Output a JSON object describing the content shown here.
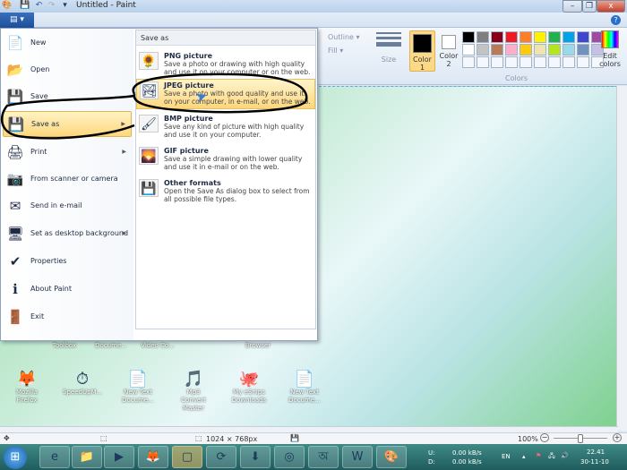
{
  "window": {
    "title": "Untitled - Paint",
    "minimize": "–",
    "restore": "❐",
    "close": "x",
    "help": "?"
  },
  "quick_access": {
    "paint": "🎨",
    "save": "💾",
    "undo": "↶",
    "redo": "↷",
    "customize": "▾"
  },
  "file_button": "▤ ▾",
  "ribbon": {
    "outline": "Outline ▾",
    "fill": "Fill ▾",
    "size": "Size",
    "color1": "Color 1",
    "color2": "Color 2",
    "edit_colors": "Edit colors",
    "colors_group": "Colors",
    "color1_value": "#000000",
    "color2_value": "#ffffff",
    "palette_row1": [
      "#000000",
      "#7f7f7f",
      "#880015",
      "#ed1c24",
      "#ff7f27",
      "#fff200",
      "#22b14c",
      "#00a2e8",
      "#3f48cc",
      "#a349a4"
    ],
    "palette_row2": [
      "#ffffff",
      "#c3c3c3",
      "#b97a57",
      "#ffaec9",
      "#ffc90e",
      "#efe4b0",
      "#b5e61d",
      "#99d9ea",
      "#7092be",
      "#c8bfe7"
    ]
  },
  "file_menu": {
    "items": [
      {
        "label": "New",
        "icon": "📄"
      },
      {
        "label": "Open",
        "icon": "📂"
      },
      {
        "label": "Save",
        "icon": "💾"
      },
      {
        "label": "Save as",
        "icon": "💾"
      },
      {
        "label": "Print",
        "icon": "🖨"
      },
      {
        "label": "From scanner or camera",
        "icon": "📷"
      },
      {
        "label": "Send in e-mail",
        "icon": "✉"
      },
      {
        "label": "Set as desktop background",
        "icon": "🖥"
      },
      {
        "label": "Properties",
        "icon": "✔"
      },
      {
        "label": "About Paint",
        "icon": "ℹ"
      },
      {
        "label": "Exit",
        "icon": "🚪"
      }
    ],
    "save_as_panel": {
      "header": "Save as",
      "options": [
        {
          "title": "PNG picture",
          "desc": "Save a photo or drawing with high quality and use it on your computer or on the web.",
          "icon": "🌻"
        },
        {
          "title": "JPEG picture",
          "desc": "Save a photo with good quality and use it on your computer, in e-mail, or on the web.",
          "icon": "🏞"
        },
        {
          "title": "BMP picture",
          "desc": "Save any kind of picture with high quality and use it on your computer.",
          "icon": "🖌"
        },
        {
          "title": "GIF picture",
          "desc": "Save a simple drawing with lower quality and use it in e-mail or on the web.",
          "icon": "🌄"
        },
        {
          "title": "Other formats",
          "desc": "Open the Save As dialog box to select from all possible file types.",
          "icon": "💾"
        }
      ]
    }
  },
  "desktop": {
    "top_labels": [
      "Toolbox",
      "Docume...",
      "Video Co...",
      "Browser"
    ],
    "icons": [
      {
        "label": "Mozilla Firefox",
        "icon": "🦊"
      },
      {
        "label": "SpeedUpM...",
        "icon": "⏱"
      },
      {
        "label": "New Text Docume...",
        "icon": "📄"
      },
      {
        "label": "Mp3 Convert Master",
        "icon": "🎵"
      },
      {
        "label": "My eSnips Downloads",
        "icon": "🐙"
      },
      {
        "label": "New Text Docume...",
        "icon": "📄"
      }
    ]
  },
  "status_bar": {
    "move": "✥",
    "selection": "⬚",
    "dimensions": "1024 × 768px",
    "save_icon": "💾",
    "zoom": "100%",
    "zoom_out": "−",
    "zoom_in": "+",
    "zoom_fraction": 0.5
  },
  "taskbar": {
    "start": "⊞",
    "apps": [
      "e",
      "📁",
      "▶",
      "🦊",
      "▢",
      "⟳",
      "⬇",
      "◎",
      "অ",
      "W",
      "🎨"
    ],
    "net_up_label": "U:",
    "net_down_label": "D:",
    "net_up": "0.00 kB/s",
    "net_down": "0.00 kB/s",
    "lang": "EN",
    "tray_arrow": "▴",
    "flag": "⚑",
    "network": "🖧",
    "volume": "🔊",
    "time": "22.41",
    "date": "30-11-10"
  }
}
